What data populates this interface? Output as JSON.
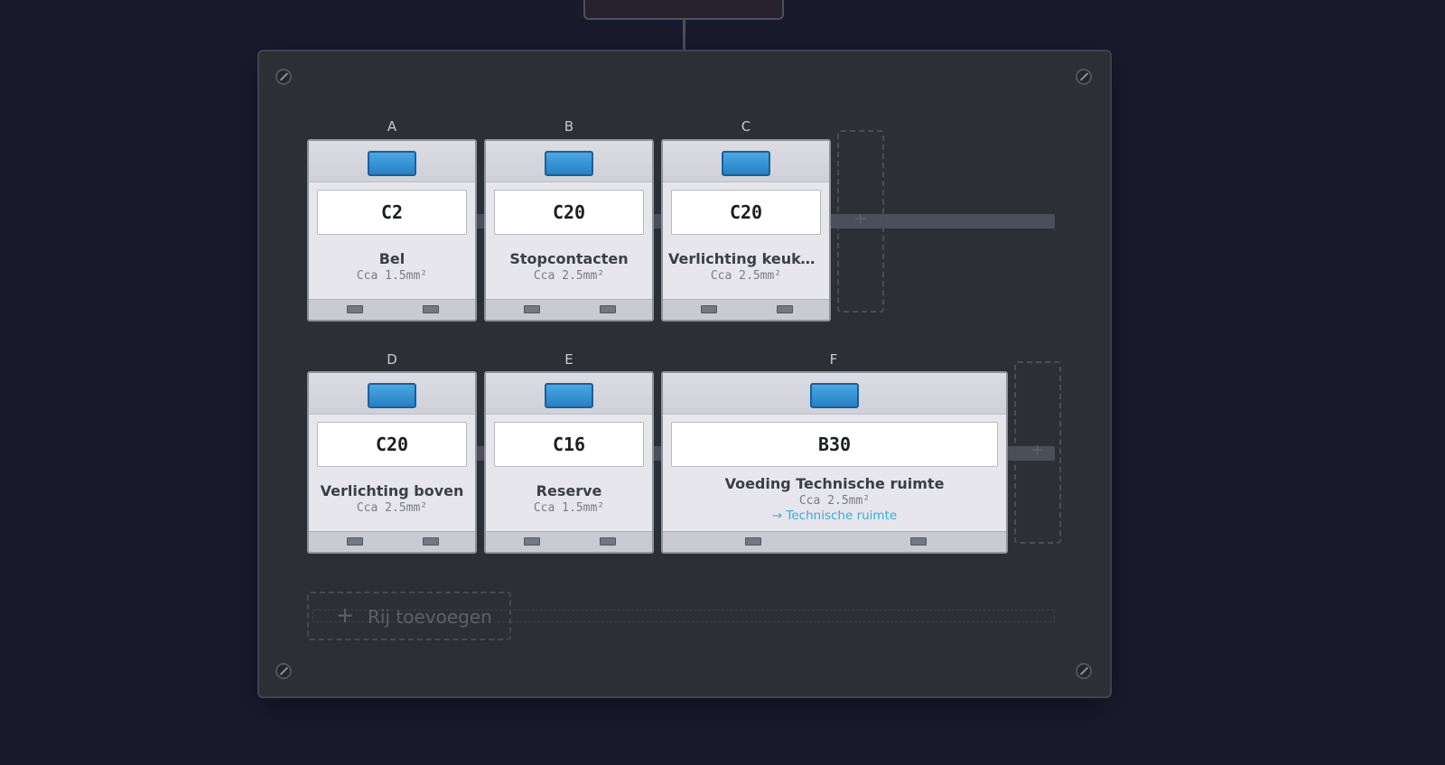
{
  "row1": [
    {
      "col": "A",
      "rating": "C2",
      "name": "Bel",
      "cable": "Cca 1.5mm²"
    },
    {
      "col": "B",
      "rating": "C20",
      "name": "Stopcontacten",
      "cable": "Cca 2.5mm²"
    },
    {
      "col": "C",
      "rating": "C20",
      "name": "Verlichting keuke…",
      "cable": "Cca 2.5mm²"
    }
  ],
  "row2": [
    {
      "col": "D",
      "rating": "C20",
      "name": "Verlichting boven",
      "cable": "Cca 2.5mm²"
    },
    {
      "col": "E",
      "rating": "C16",
      "name": "Reserve",
      "cable": "Cca 1.5mm²"
    },
    {
      "col": "F",
      "rating": "B30",
      "name": "Voeding Technische ruimte",
      "cable": "Cca 2.5mm²",
      "link": "→ Technische ruimte"
    }
  ],
  "add_slot_symbol": "+",
  "add_row": {
    "symbol": "+",
    "label": "Rij toevoegen"
  },
  "colors": {
    "background": "#191a2c",
    "panel": "#2c2f36",
    "toggle": "#3093d4",
    "link": "#3aaadf"
  }
}
